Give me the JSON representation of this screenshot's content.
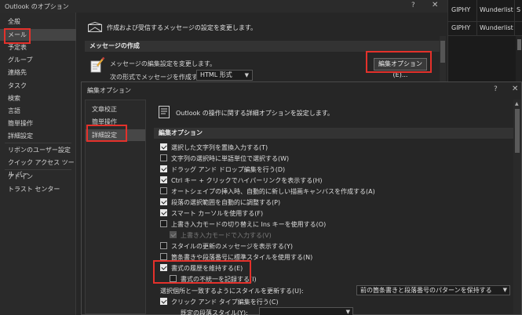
{
  "outer_window": {
    "title": "Outlook のオプション",
    "help": "?",
    "close": "✕",
    "nav_items": [
      {
        "label": "全般"
      },
      {
        "label": "メール"
      },
      {
        "label": "予定表"
      },
      {
        "label": "グループ"
      },
      {
        "label": "連絡先"
      },
      {
        "label": "タスク"
      },
      {
        "label": "検索"
      },
      {
        "label": "言語"
      },
      {
        "label": "簡単操作"
      },
      {
        "label": "詳細設定"
      },
      {
        "label": "リボンのユーザー設定"
      },
      {
        "label": "クイック アクセス ツール バー"
      },
      {
        "label": "アドイン"
      },
      {
        "label": "トラスト センター"
      }
    ],
    "active_nav": "メール",
    "header": "作成および受信するメッセージの設定を変更します。",
    "compose_section": "メッセージの作成",
    "compose_desc": "メッセージの編集設定を変更します。",
    "compose_format_label": "次の形式でメッセージを作成する(C):",
    "compose_format_value": "HTML 形式",
    "editor_options_button": "編集オプション(E)..."
  },
  "ribbon": {
    "items": [
      "GIPHY",
      "Wunderlist",
      "S",
      "GIPHY",
      "Wunderlist"
    ]
  },
  "inner_dialog": {
    "title": "編集オプション",
    "help": "?",
    "close": "✕",
    "nav_items": [
      {
        "label": "文章校正"
      },
      {
        "label": "簡単操作"
      },
      {
        "label": "詳細設定"
      }
    ],
    "active_nav": "詳細設定",
    "header": "Outlook の操作に関する詳細オプションを設定します。",
    "section": "編集オプション",
    "options": [
      {
        "label": "選択した文字列を置換入力する(T)",
        "checked": true
      },
      {
        "label": "文字列の選択時に単語単位で選択する(W)",
        "checked": false
      },
      {
        "label": "ドラッグ アンド ドロップ編集を行う(D)",
        "checked": true
      },
      {
        "label": "Ctrl キー + クリックでハイパーリンクを表示する(H)",
        "checked": true
      },
      {
        "label": "オートシェイプの挿入時、自動的に新しい描画キャンバスを作成する(A)",
        "checked": false
      },
      {
        "label": "段落の選択範囲を自動的に調整する(P)",
        "checked": true
      },
      {
        "label": "スマート カーソルを使用する(F)",
        "checked": true
      },
      {
        "label": "上書き入力モードの切り替えに Ins キーを使用する(O)",
        "checked": false
      },
      {
        "label": "上書き入力モードで入力する(V)",
        "checked": true,
        "disabled": true
      },
      {
        "label": "スタイルの更新のメッセージを表示する(Y)",
        "checked": false
      },
      {
        "label": "箇条書きや段落番号に標準スタイルを使用する(N)",
        "checked": false
      },
      {
        "label": "書式の履歴を維持する(E)",
        "checked": true
      },
      {
        "label": "書式の不統一を記録する(I)",
        "checked": false
      }
    ],
    "style_update_label": "選択個所と一致するようにスタイルを更新する(U):",
    "style_update_value": "前の箇条書きと段落番号のパターンを保持する",
    "click_type_label": "クリック アンド タイプ編集を行う(C)",
    "click_type_checked": true,
    "default_style_label": "既定の段落スタイル(Y):"
  }
}
